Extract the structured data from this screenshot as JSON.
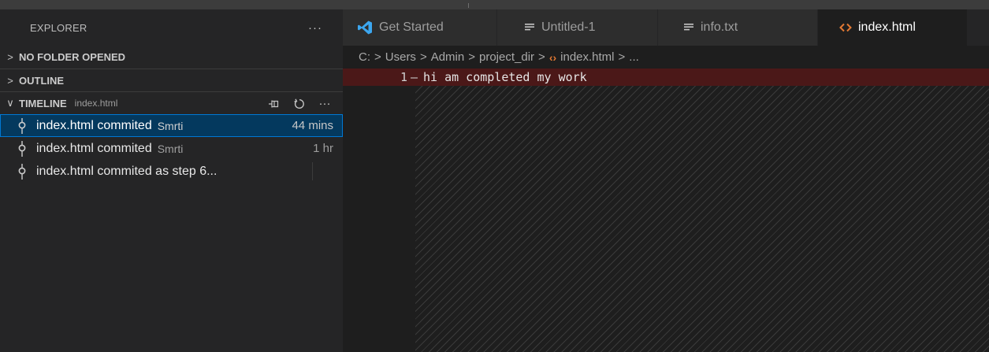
{
  "sidebar": {
    "title": "EXPLORER",
    "more": "···",
    "sections": {
      "no_folder": {
        "title": "NO FOLDER OPENED",
        "chevron": ">"
      },
      "outline": {
        "title": "OUTLINE",
        "chevron": ">"
      },
      "timeline": {
        "title": "TIMELINE",
        "subtitle": "index.html",
        "chevron": "∨",
        "more": "···"
      }
    },
    "timeline_items": [
      {
        "label": "index.html commited",
        "author": "Smrti",
        "time": "44 mins",
        "selected": true
      },
      {
        "label": "index.html commited",
        "author": "Smrti",
        "time": "1 hr",
        "selected": false
      },
      {
        "label": "index.html commited as step 6...",
        "author": "",
        "time": "",
        "selected": false
      }
    ]
  },
  "tabs": [
    {
      "label": "Get Started",
      "icon": "vscode-logo-icon"
    },
    {
      "label": "Untitled-1",
      "icon": "text-file-icon"
    },
    {
      "label": "info.txt",
      "icon": "text-file-icon"
    },
    {
      "label": "index.html",
      "icon": "html-file-icon"
    }
  ],
  "breadcrumb": {
    "parts": [
      "C:",
      "Users",
      "Admin",
      "project_dir"
    ],
    "file": "index.html",
    "tail": "...",
    "sep": ">"
  },
  "editor": {
    "line_number": "1",
    "line_marker": "—",
    "line_text": "hi am completed my work"
  },
  "colors": {
    "accent": "#0078d4",
    "deleted_line": "#4b1818",
    "html_icon": "#e37933",
    "vscode_blue": "#3ca7f0"
  }
}
